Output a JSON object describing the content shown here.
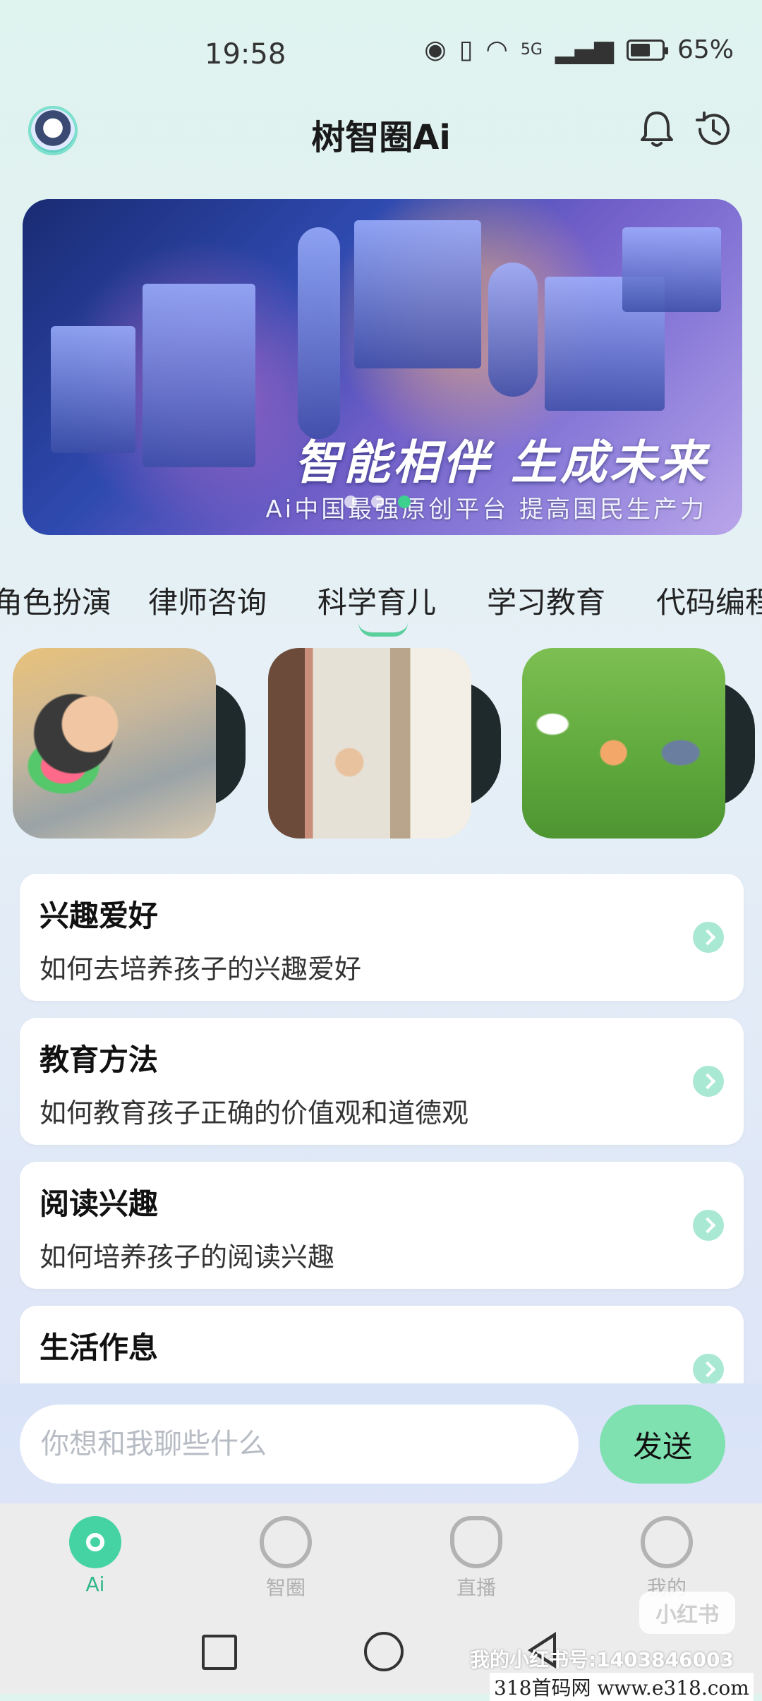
{
  "status_bar": {
    "time": "19:58",
    "network": "5G",
    "battery": "65%",
    "battery_level": 0.65
  },
  "header": {
    "title": "树智圈Ai"
  },
  "banner": {
    "headline": "智能相伴 生成未来",
    "subtitle": "Ai中国最强原创平台 提高国民生产力",
    "page_count": 3,
    "active_page": 3
  },
  "tabs": [
    {
      "label": "角色扮演"
    },
    {
      "label": "律师咨询"
    },
    {
      "label": "科学育儿",
      "active": true
    },
    {
      "label": "学习教育"
    },
    {
      "label": "代码编程"
    }
  ],
  "topics": [
    {
      "title": "兴趣爱好",
      "subtitle": "如何去培养孩子的兴趣爱好"
    },
    {
      "title": "教育方法",
      "subtitle": "如何教育孩子正确的价值观和道德观"
    },
    {
      "title": "阅读兴趣",
      "subtitle": "如何培养孩子的阅读兴趣"
    },
    {
      "title": "生活作息",
      "subtitle": ""
    }
  ],
  "chat": {
    "placeholder": "你想和我聊些什么",
    "send_label": "发送"
  },
  "bottom_nav": [
    {
      "label": "Ai",
      "active": true
    },
    {
      "label": "智圈"
    },
    {
      "label": "直播"
    },
    {
      "label": "我的"
    }
  ],
  "watermarks": {
    "logo": "小红书",
    "id": "我的小红书号:1403846003",
    "site": "318首码网 www.e318.com"
  },
  "colors": {
    "accent": "#46d3a4",
    "send_button": "#7fe0b0"
  }
}
